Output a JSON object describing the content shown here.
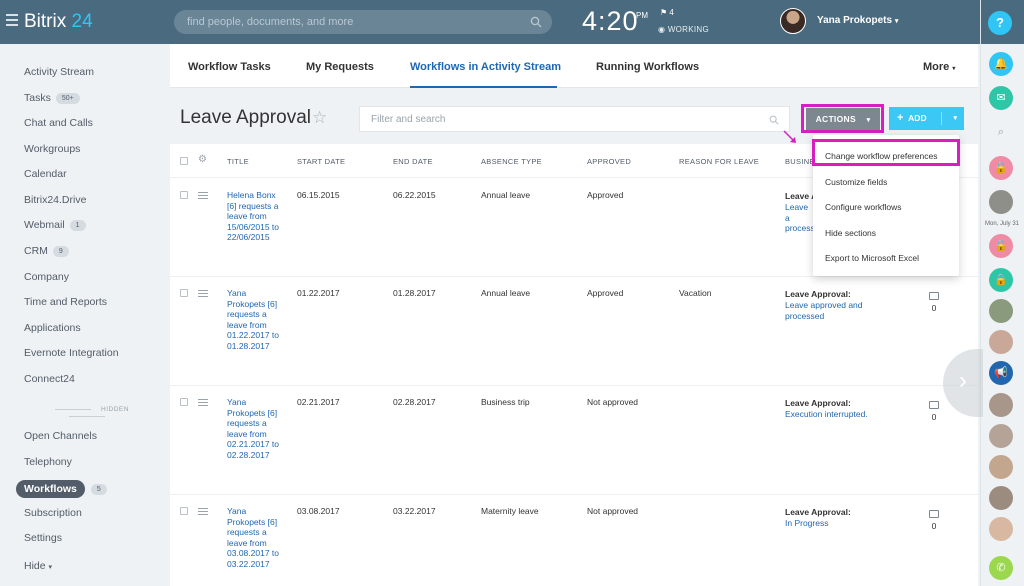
{
  "header": {
    "logo_main": "Bitrix",
    "logo_num": "24",
    "search_placeholder": "find people, documents, and more",
    "clock": "4:20",
    "ampm": "PM",
    "flag_count": "4",
    "status": "WORKING",
    "user_name": "Yana Prokopets"
  },
  "rail": {
    "help": "?",
    "date_label": "Mon, July 31"
  },
  "menu": {
    "items": [
      {
        "label": "Activity Stream"
      },
      {
        "label": "Tasks",
        "badge": "50+"
      },
      {
        "label": "Chat and Calls"
      },
      {
        "label": "Workgroups"
      },
      {
        "label": "Calendar"
      },
      {
        "label": "Bitrix24.Drive"
      },
      {
        "label": "Webmail",
        "badge": "1"
      },
      {
        "label": "CRM",
        "badge": "9"
      },
      {
        "label": "Company"
      },
      {
        "label": "Time and Reports"
      },
      {
        "label": "Applications"
      },
      {
        "label": "Evernote Integration"
      },
      {
        "label": "Connect24"
      }
    ],
    "hidden_label": "HIDDEN",
    "hidden_items": [
      {
        "label": "Open Channels"
      },
      {
        "label": "Telephony"
      },
      {
        "label": "Workflows",
        "badge": "5"
      },
      {
        "label": "Subscription"
      },
      {
        "label": "Settings"
      }
    ],
    "hide_label": "Hide"
  },
  "tabs": {
    "workflow_tasks": "Workflow Tasks",
    "my_requests": "My Requests",
    "workflows_activity": "Workflows in Activity Stream",
    "running": "Running Workflows",
    "more": "More"
  },
  "page": {
    "title": "Leave Approval",
    "filter_placeholder": "Filter and search",
    "actions": "ACTIONS",
    "add": "ADD"
  },
  "table": {
    "columns": [
      "TITLE",
      "START DATE",
      "END DATE",
      "ABSENCE TYPE",
      "APPROVED",
      "REASON FOR LEAVE",
      "BUSINE"
    ],
    "rows": [
      {
        "title": "Helena Bonx [6] requests a leave from 15/06/2015 to 22/06/2015",
        "start": "06.15.2015",
        "end": "06.22.2015",
        "type": "Annual leave",
        "approved": "Approved",
        "reason": "",
        "bp_label": "Leave A",
        "bp_status": "Leave a process",
        "comments": ""
      },
      {
        "title": "Yana Prokopets [6] requests a leave from 01.22.2017 to 01.28.2017",
        "start": "01.22.2017",
        "end": "01.28.2017",
        "type": "Annual leave",
        "approved": "Approved",
        "reason": "Vacation",
        "bp_label": "Leave Approval:",
        "bp_status": "Leave approved and processed",
        "comments": "0"
      },
      {
        "title": "Yana Prokopets [6] requests a leave from 02.21.2017 to 02.28.2017",
        "start": "02.21.2017",
        "end": "02.28.2017",
        "type": "Business trip",
        "approved": "Not approved",
        "reason": "",
        "bp_label": "Leave Approval:",
        "bp_status": "Execution interrupted.",
        "comments": "0"
      },
      {
        "title": "Yana Prokopets [6] requests a leave from 03.08.2017 to 03.22.2017",
        "start": "03.08.2017",
        "end": "03.22.2017",
        "type": "Maternity leave",
        "approved": "Not approved",
        "reason": "",
        "bp_label": "Leave Approval:",
        "bp_status": "In Progress",
        "comments": "0"
      }
    ]
  },
  "dropdown": {
    "items": [
      "Change workflow preferences",
      "Customize fields",
      "Configure workflows",
      "Hide sections",
      "Export to Microsoft Excel"
    ]
  },
  "colors": {
    "header_bg": "#4a6b7f",
    "accent": "#2fc6f6",
    "link": "#2067b0",
    "highlight": "#d61ec1",
    "add_button": "#3bc8f5"
  }
}
